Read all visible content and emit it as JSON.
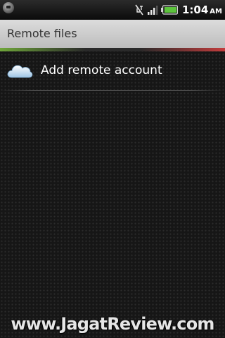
{
  "status_bar": {
    "time": "1:04",
    "ampm": "AM",
    "icons": [
      "app-notification-icon",
      "no-sync-icon",
      "signal-strength-icon",
      "battery-icon"
    ],
    "battery_color": "#5cc33c"
  },
  "header": {
    "title": "Remote files"
  },
  "list": {
    "items": [
      {
        "label": "Add remote account",
        "icon": "cloud-icon"
      }
    ]
  },
  "watermark": {
    "text": "www.JagatReview.com"
  },
  "colors": {
    "title_bar_bg": "#cfcfcf",
    "background": "#161616",
    "text": "#ffffff"
  }
}
